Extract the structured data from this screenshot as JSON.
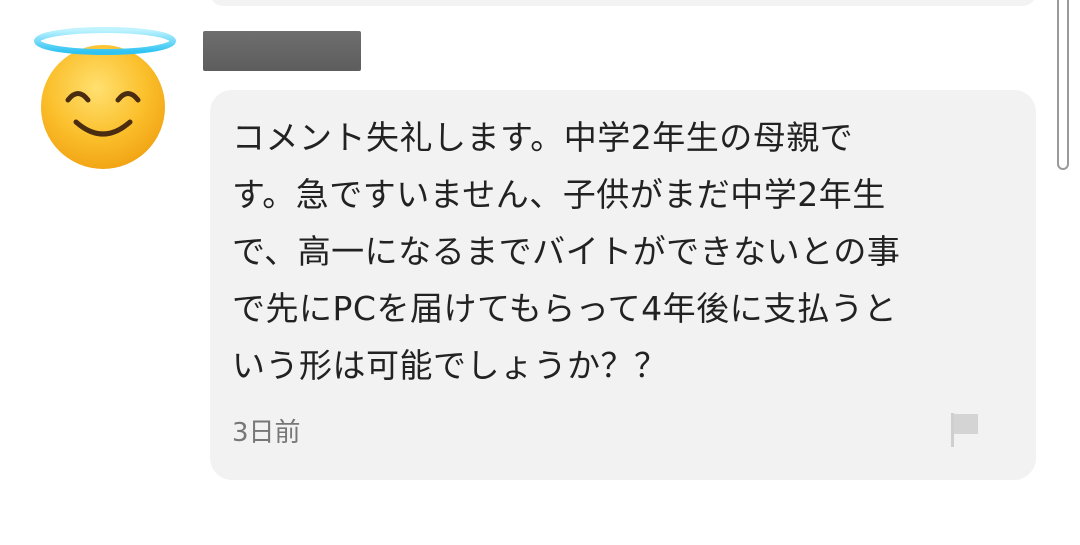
{
  "comment": {
    "lines": [
      "コメント失礼します。中学2年生の母親で",
      "す。急ですいません、子供がまだ中学2年生",
      "で、高一になるまでバイトができないとの事",
      "で先にPCを届けてもらって4年後に支払うと",
      "いう形は可能でしょうか？？"
    ],
    "timestamp": "3日前"
  },
  "icons": {
    "avatar": "smiling-face-with-halo-emoji",
    "flag": "report-flag-icon"
  },
  "colors": {
    "card_background": "#f2f2f2",
    "text": "#222222",
    "timestamp": "#777777",
    "flag": "#cfcfcf",
    "redacted_name": "#636363"
  }
}
